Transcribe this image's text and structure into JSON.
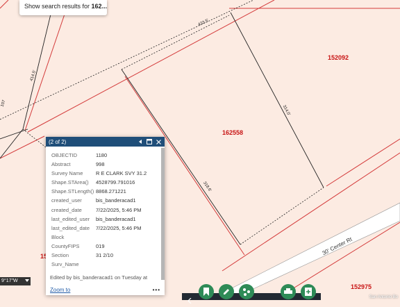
{
  "search_tip": {
    "prefix": "Show search results for ",
    "query": "162..."
  },
  "map": {
    "parcels": [
      "152092",
      "162558",
      "152975",
      "15"
    ],
    "dimensions": [
      "433.5'",
      "414.5'",
      "107",
      "314.0'",
      "318.6'"
    ],
    "road_name": "30' Center Rt",
    "coordinate_readout": "9°17\"W",
    "credit": "San Antonio Bo"
  },
  "popup": {
    "title": "(2 of 2)",
    "attributes": [
      {
        "key": "OBJECTID",
        "value": "1180"
      },
      {
        "key": "Abstract",
        "value": "998"
      },
      {
        "key": "Survey Name",
        "value": "R E CLARK SVY 31.2"
      },
      {
        "key": "Shape.STArea()",
        "value": "4528799.791016"
      },
      {
        "key": "Shape.STLength()",
        "value": "8868.271221"
      },
      {
        "key": "created_user",
        "value": "bis_banderacad1"
      },
      {
        "key": "created_date",
        "value": "7/22/2025, 5:46 PM"
      },
      {
        "key": "last_edited_user",
        "value": "bis_banderacad1"
      },
      {
        "key": "last_edited_date",
        "value": "7/22/2025, 5:46 PM"
      },
      {
        "key": "Block",
        "value": ""
      },
      {
        "key": "CountyFIPS",
        "value": "019"
      },
      {
        "key": "Section",
        "value": "31 2/10"
      },
      {
        "key": "Surv_Name",
        "value": ""
      }
    ],
    "edit_note": "Edited by bis_banderacad1 on Tuesday at",
    "zoom_to": "Zoom to",
    "more": "•••"
  },
  "colors": {
    "map_bg": "#fcebe2",
    "parcel_line": "#d43b3b",
    "popup_header": "#1f4e79",
    "tool_green": "#2e8b57"
  },
  "toolbar": {
    "icons": [
      "bookmark-icon",
      "edit-icon",
      "analysis-icon",
      "print-icon",
      "add-data-icon"
    ]
  }
}
